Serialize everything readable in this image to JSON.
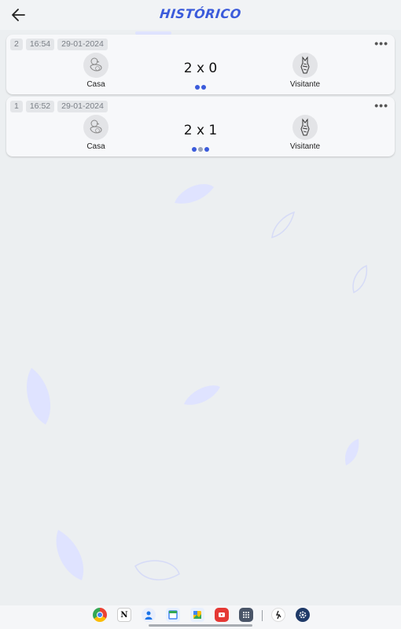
{
  "header": {
    "title": "HISTÓRICO"
  },
  "matches": [
    {
      "number": "2",
      "time": "16:54",
      "date": "29-01-2024",
      "home": "Casa",
      "away": "Visitante",
      "score": "2 x 0"
    },
    {
      "number": "1",
      "time": "16:52",
      "date": "29-01-2024",
      "home": "Casa",
      "away": "Visitante",
      "score": "2 x 1"
    }
  ],
  "more_label": "•••",
  "colors": {
    "accent": "#3b5bdb",
    "background": "#eceff1",
    "card": "#f7f8fa",
    "leaf": "#dde2ff"
  },
  "dock_icons": [
    "chrome-icon",
    "notion-icon",
    "contacts-icon",
    "calendar-icon",
    "gallery-icon",
    "youtube-icon",
    "app-drawer-icon",
    "running-app-icon",
    "settings-icon"
  ]
}
